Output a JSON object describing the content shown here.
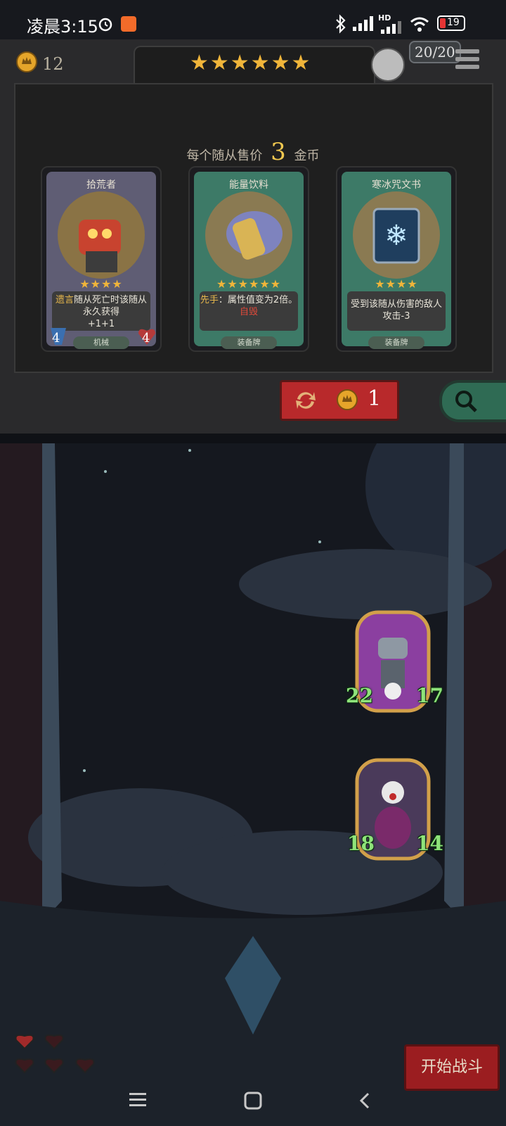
{
  "status_bar": {
    "time": "凌晨3:15",
    "network_label": "HD",
    "battery": "19"
  },
  "shop": {
    "gold_count": "12",
    "tavern_tier_stars": "★★★★★★",
    "health_badge": "20/20",
    "sell_prefix": "每个随从售价",
    "sell_price": "3",
    "sell_suffix": "金币",
    "cards": [
      {
        "name": "拾荒者",
        "stars": "★★★★",
        "desc_keyword": "遗言",
        "desc_rest": "随从死亡时该随从永久获得",
        "desc_stats": "+1+1",
        "attack": "4",
        "health": "4",
        "tag": "机械"
      },
      {
        "name": "能量饮料",
        "stars": "★★★★★★",
        "desc_keyword": "先手",
        "desc_rest": "：属性值变为2倍。",
        "desc_bad": "自毁",
        "tag": "装备牌"
      },
      {
        "name": "寒冰咒文书",
        "stars": "★★★★",
        "desc_line": "受到该随从伤害的敌人攻击-3",
        "tag": "装备牌"
      }
    ],
    "refresh_cost": "1"
  },
  "battle": {
    "minions": [
      {
        "attack": "22",
        "health": "17"
      },
      {
        "attack": "18",
        "health": "14"
      }
    ],
    "lives_total": 5,
    "start_button": "开始战斗"
  },
  "colors": {
    "gold": "#f0b53a",
    "shop_bg": "#2a2a2c",
    "refresh_red": "#b8292b",
    "search_green": "#2f6b54",
    "stat_green": "#8fe37a"
  }
}
